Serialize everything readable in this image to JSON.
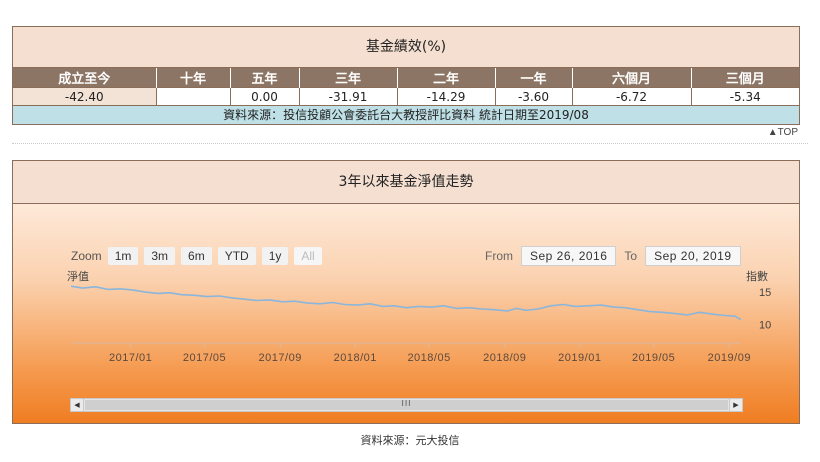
{
  "performance": {
    "title": "基金績效(%)",
    "headers": [
      "成立至今",
      "十年",
      "五年",
      "三年",
      "二年",
      "一年",
      "六個月",
      "三個月"
    ],
    "values": [
      "-42.40",
      "",
      "0.00",
      "-31.91",
      "-14.29",
      "-3.60",
      "-6.72",
      "-5.34"
    ],
    "source": "資料來源：投信投顧公會委託台大教授評比資料 統計日期至2019/08"
  },
  "top_link": "▲TOP",
  "chart": {
    "title": "3年以來基金淨值走勢",
    "zoom_label": "Zoom",
    "zoom_options": [
      "1m",
      "3m",
      "6m",
      "YTD",
      "1y",
      "All"
    ],
    "from_label": "From",
    "from_date": "Sep 26, 2016",
    "to_label": "To",
    "to_date": "Sep 20, 2019",
    "left_axis_label": "淨值",
    "right_axis_label": "指數",
    "scroll_grip": "III"
  },
  "chart_data": {
    "type": "line",
    "title": "3年以來基金淨值走勢",
    "xlabel": "",
    "ylabel": "淨值",
    "ylabel_right": "指數",
    "x_tick_labels": [
      "2017/01",
      "2017/05",
      "2017/09",
      "2018/01",
      "2018/05",
      "2018/09",
      "2019/01",
      "2019/05",
      "2019/09"
    ],
    "y_tick_labels": [
      "15",
      "10"
    ],
    "ylim": [
      7.5,
      17
    ],
    "grid": false,
    "series": [
      {
        "color": "#8ab6dc",
        "x": [
          "2016-09-26",
          "2016-10-15",
          "2016-11-05",
          "2016-11-25",
          "2016-12-15",
          "2017-01-05",
          "2017-01-25",
          "2017-02-15",
          "2017-03-05",
          "2017-03-25",
          "2017-04-15",
          "2017-05-05",
          "2017-05-25",
          "2017-06-15",
          "2017-07-05",
          "2017-07-25",
          "2017-08-15",
          "2017-09-05",
          "2017-09-25",
          "2017-10-15",
          "2017-11-05",
          "2017-11-25",
          "2017-12-15",
          "2018-01-05",
          "2018-01-25",
          "2018-02-15",
          "2018-03-05",
          "2018-03-25",
          "2018-04-15",
          "2018-05-05",
          "2018-05-25",
          "2018-06-15",
          "2018-07-05",
          "2018-07-25",
          "2018-08-15",
          "2018-09-05",
          "2018-09-20",
          "2018-10-05",
          "2018-10-25",
          "2018-11-15",
          "2018-12-05",
          "2018-12-25",
          "2019-01-15",
          "2019-02-05",
          "2019-02-25",
          "2019-03-15",
          "2019-04-05",
          "2019-04-25",
          "2019-05-15",
          "2019-06-05",
          "2019-06-25",
          "2019-07-15",
          "2019-08-05",
          "2019-08-25",
          "2019-09-10",
          "2019-09-20"
        ],
        "y": [
          15.9,
          15.6,
          15.8,
          15.4,
          15.5,
          15.3,
          15.0,
          14.8,
          14.9,
          14.6,
          14.5,
          14.3,
          14.4,
          14.1,
          13.9,
          13.7,
          13.8,
          13.5,
          13.6,
          13.3,
          13.2,
          13.4,
          13.1,
          13.0,
          13.2,
          12.8,
          12.9,
          12.6,
          12.8,
          12.7,
          12.9,
          12.5,
          12.6,
          12.4,
          12.3,
          12.1,
          12.5,
          12.2,
          12.4,
          12.9,
          13.1,
          12.8,
          12.9,
          13.0,
          12.7,
          12.6,
          12.3,
          12.0,
          11.9,
          11.7,
          11.5,
          11.9,
          11.6,
          11.4,
          11.3,
          10.8
        ]
      }
    ]
  },
  "footer_source": "資料來源：元大投信"
}
